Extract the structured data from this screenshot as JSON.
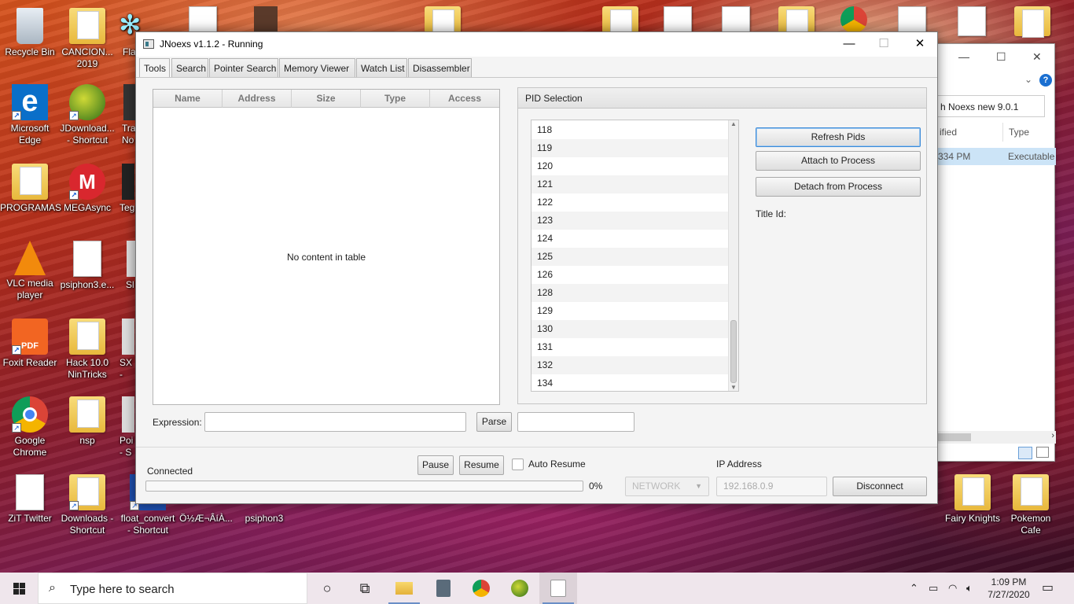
{
  "desktop": {
    "icons": [
      {
        "label": "Recycle Bin"
      },
      {
        "label": "CANCION... 2019"
      },
      {
        "label": "Microsoft Edge"
      },
      {
        "label": "JDownload... - Shortcut"
      },
      {
        "label": "PROGRAMAS"
      },
      {
        "label": "MEGAsync"
      },
      {
        "label": "VLC media player"
      },
      {
        "label": "psiphon3.e..."
      },
      {
        "label": "Foxit Reader"
      },
      {
        "label": "Hack 10.0 NinTricks"
      },
      {
        "label": "Google Chrome"
      },
      {
        "label": "nsp"
      },
      {
        "label": "ZiT Twitter"
      },
      {
        "label": "Downloads - Shortcut"
      },
      {
        "label": "float_convert - Shortcut"
      },
      {
        "label": "Ö½Æ¬ÂíÀ..."
      },
      {
        "label": "psiphon3"
      },
      {
        "label": "Fairy Knights"
      },
      {
        "label": "Pokemon Cafe"
      }
    ],
    "partial_labels": [
      "Fla",
      "Tra No",
      "Teg",
      "Sl",
      "SX -",
      "Poi - S"
    ]
  },
  "explorer": {
    "search_value": "h Noexs new 9.0.1",
    "col_modified": "ified",
    "col_type": "Type",
    "row_time": "334 PM",
    "row_type": "Executable"
  },
  "window": {
    "title": "JNoexs v1.1.2 - Running",
    "minimize": "—",
    "maximize": "☐",
    "close": "✕"
  },
  "tabs": [
    "Tools",
    "Search",
    "Pointer Search",
    "Memory Viewer",
    "Watch List",
    "Disassembler"
  ],
  "table": {
    "columns": [
      "Name",
      "Address",
      "Size",
      "Type",
      "Access"
    ],
    "empty_text": "No content in table"
  },
  "expression": {
    "label": "Expression:",
    "value": "",
    "parse_label": "Parse",
    "result": ""
  },
  "pid": {
    "header": "PID Selection",
    "items": [
      "118",
      "119",
      "120",
      "121",
      "122",
      "123",
      "124",
      "125",
      "126",
      "128",
      "129",
      "130",
      "131",
      "132",
      "134"
    ],
    "refresh_label": "Refresh Pids",
    "attach_label": "Attach to Process",
    "detach_label": "Detach from Process",
    "title_id_label": "Title Id:"
  },
  "status": {
    "connected": "Connected",
    "progress_text": "0%",
    "progress_value": 0,
    "pause_label": "Pause",
    "resume_label": "Resume",
    "auto_resume_label": "Auto Resume",
    "auto_resume_checked": false,
    "network_value": "NETWORK",
    "ip_label": "IP Address",
    "ip_value": "192.168.0.9",
    "disconnect_label": "Disconnect"
  },
  "taskbar": {
    "search_placeholder": "Type here to search",
    "time": "1:09 PM",
    "date": "7/27/2020"
  }
}
